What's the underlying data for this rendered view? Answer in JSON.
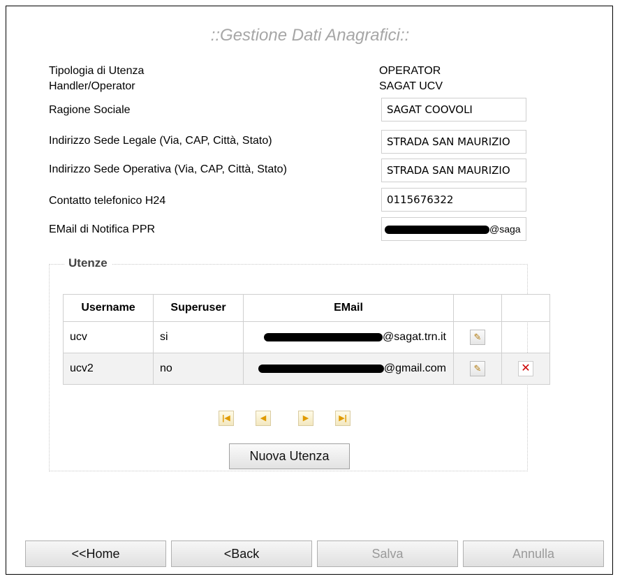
{
  "page": {
    "title": "::Gestione Dati Anagrafici::"
  },
  "info": {
    "tipologia_label": "Tipologia di Utenza",
    "tipologia_value": "OPERATOR",
    "handler_label": "Handler/Operator",
    "handler_value": "SAGAT UCV"
  },
  "form": {
    "ragione_label": "Ragione Sociale",
    "ragione_value": "SAGAT COOVOLI",
    "legale_label": "Indirizzo Sede Legale (Via, CAP, Città, Stato)",
    "legale_value": "STRADA SAN MAURIZIO",
    "operativa_label": "Indirizzo Sede Operativa (Via, CAP, Città, Stato)",
    "operativa_value": "STRADA SAN MAURIZIO",
    "telefono_label": "Contatto telefonico H24",
    "telefono_value": "0115676322",
    "email_label": "EMail di Notifica PPR",
    "email_visible_suffix": "@saga"
  },
  "utenze": {
    "legend": "Utenze",
    "columns": [
      "Username",
      "Superuser",
      "EMail",
      "",
      ""
    ],
    "rows": [
      {
        "username": "ucv",
        "superuser": "si",
        "email_suffix": "@sagat.trn.it",
        "deletable": false
      },
      {
        "username": "ucv2",
        "superuser": "no",
        "email_suffix": "@gmail.com",
        "deletable": true
      }
    ],
    "pager_icons": [
      "first-page-icon",
      "prev-page-icon",
      "next-page-icon",
      "last-page-icon"
    ],
    "new_button": "Nuova Utenza"
  },
  "footer": {
    "home": "<<Home",
    "back": "<Back",
    "save": "Salva",
    "cancel": "Annulla"
  },
  "colors": {
    "title": "#a6a6a6",
    "delete": "#cc0000",
    "pager": "#e09a00"
  }
}
